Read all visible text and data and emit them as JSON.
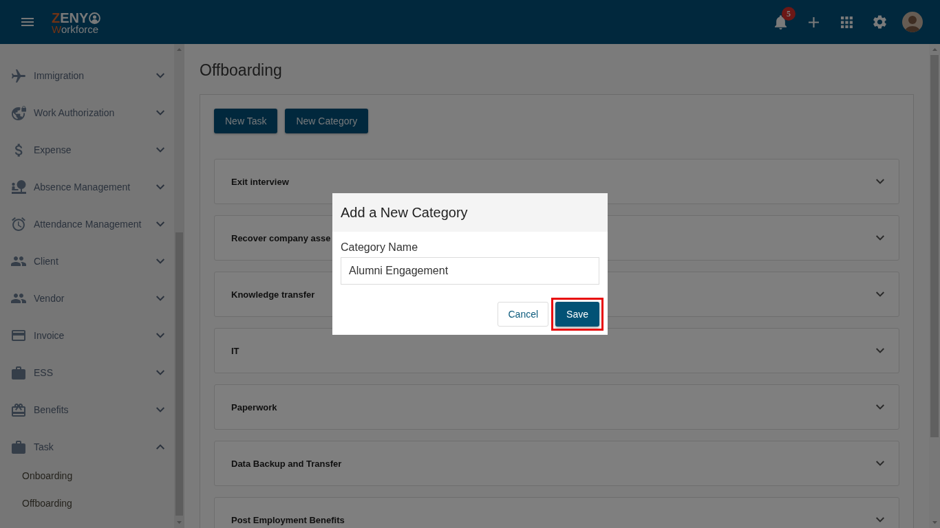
{
  "header": {
    "logo": {
      "name": "ZENY",
      "tagline": "Workforce"
    },
    "notifications": {
      "count": "5"
    }
  },
  "sidebar": {
    "items": [
      {
        "label": "Immigration",
        "expanded": false
      },
      {
        "label": "Work Authorization",
        "expanded": false
      },
      {
        "label": "Expense",
        "expanded": false
      },
      {
        "label": "Absence Management",
        "expanded": false
      },
      {
        "label": "Attendance Management",
        "expanded": false
      },
      {
        "label": "Client",
        "expanded": false
      },
      {
        "label": "Vendor",
        "expanded": false
      },
      {
        "label": "Invoice",
        "expanded": false
      },
      {
        "label": "ESS",
        "expanded": false
      },
      {
        "label": "Benefits",
        "expanded": false
      },
      {
        "label": "Task",
        "expanded": true,
        "children": [
          {
            "label": "Onboarding"
          },
          {
            "label": "Offboarding"
          }
        ]
      }
    ]
  },
  "page": {
    "title": "Offboarding",
    "actions": [
      "New Task",
      "New Category"
    ],
    "categories": [
      {
        "title": "Exit interview",
        "expanded": false
      },
      {
        "title": "Recover company asse",
        "expanded": false
      },
      {
        "title": "Knowledge transfer",
        "expanded": false
      },
      {
        "title": "IT",
        "expanded": false
      },
      {
        "title": "Paperwork",
        "expanded": false
      },
      {
        "title": "Data Backup and Transfer",
        "expanded": false
      },
      {
        "title": "Post Employment Benefits",
        "expanded": false
      }
    ]
  },
  "modal": {
    "title": "Add a New Category",
    "field": {
      "label": "Category Name",
      "value": "Alumni Engagement"
    },
    "buttons": [
      {
        "label": "Cancel",
        "kind": "secondary",
        "highlighted": false
      },
      {
        "label": "Save",
        "kind": "primary",
        "highlighted": true
      }
    ]
  }
}
